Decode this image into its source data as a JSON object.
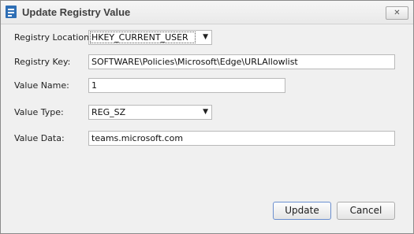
{
  "dialog": {
    "title": "Update Registry Value",
    "close_glyph": "✕",
    "fields": {
      "registry_location": {
        "label": "Registry Location:",
        "value": "HKEY_CURRENT_USER"
      },
      "registry_key": {
        "label": "Registry Key:",
        "value": "SOFTWARE\\Policies\\Microsoft\\Edge\\URLAllowlist"
      },
      "value_name": {
        "label": "Value Name:",
        "value": "1"
      },
      "value_type": {
        "label": "Value Type:",
        "value": "REG_SZ"
      },
      "value_data": {
        "label": "Value Data:",
        "value": "teams.microsoft.com"
      }
    },
    "buttons": {
      "update": "Update",
      "cancel": "Cancel"
    },
    "icons": {
      "app": "registry-editor-icon",
      "dropdown": "chevron-down-icon",
      "close": "close-icon"
    }
  }
}
